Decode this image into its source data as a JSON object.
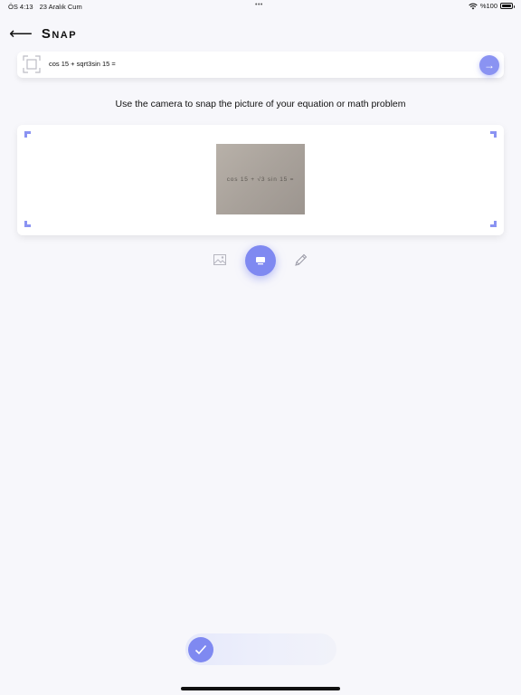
{
  "status_bar": {
    "time": "ÖS 4:13",
    "date": "23 Aralık Cum",
    "dots": "•••",
    "battery_label": "%100"
  },
  "header": {
    "back_icon": "arrow-left-icon",
    "title": "Snap"
  },
  "equation_bar": {
    "scan_icon": "scan-frame-icon",
    "equation_text": "cos 15 + sqrt3sin 15 =",
    "go_icon": "arrow-right-icon"
  },
  "instruction": "Use the camera to snap the picture of your equation or math problem",
  "camera": {
    "photo_text": "cos 15 + √3 sin 15 ="
  },
  "toolbar": {
    "gallery_icon": "image-icon",
    "snap_icon": "camera-shutter-icon",
    "pencil_icon": "pencil-icon"
  },
  "confirm": {
    "icon": "checkmark-icon"
  },
  "colors": {
    "accent": "#7f89f1",
    "accent_light": "#8a93f2",
    "background": "#f7f7fb",
    "card": "#ffffff"
  }
}
